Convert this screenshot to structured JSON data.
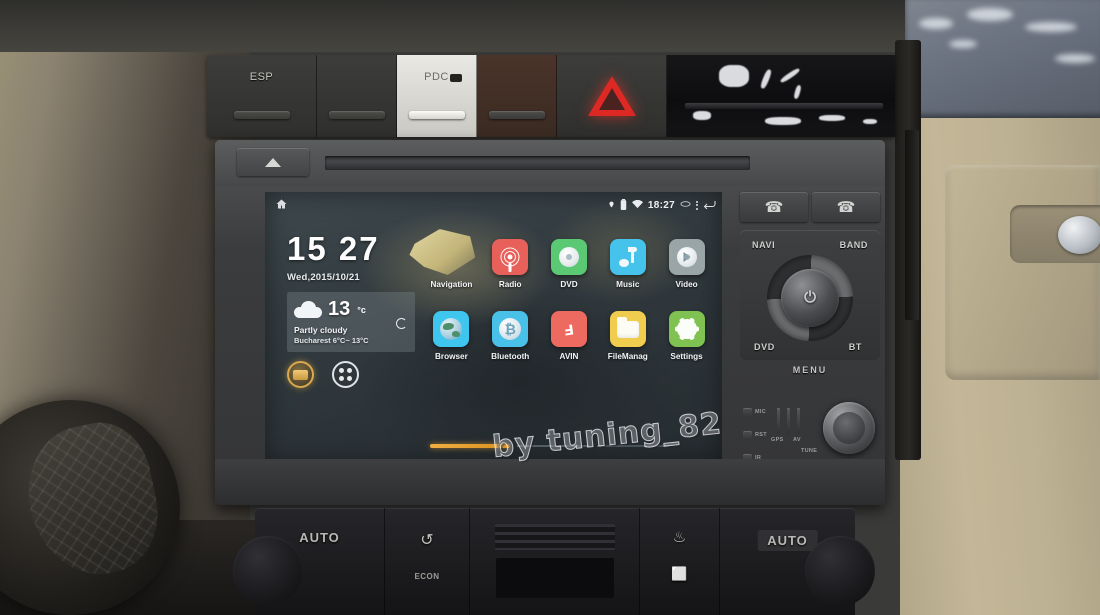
{
  "vehicle": {
    "switch_panel": {
      "esp_label": "ESP",
      "pdc_label": "PDC",
      "hazard_name": "hazard-warning"
    },
    "climate": {
      "auto_left": "AUTO",
      "auto_right": "AUTO",
      "recirc_glyph": "↺",
      "defrost_glyph": "♨",
      "rear_defrost_glyph": "⬜",
      "econ_label": "ECON"
    }
  },
  "head_unit": {
    "eject_label": "▲",
    "phone_answer_glyph": "✆",
    "phone_end_glyph": "✆",
    "knob_labels": {
      "navi": "NAVI",
      "band": "BAND",
      "dvd": "DVD",
      "bt": "BT",
      "power_glyph": "⏻"
    },
    "menu_label": "MENU",
    "mini_labels": {
      "mic": "MIC",
      "rst": "RST",
      "ir": "IR",
      "gps": "GPS",
      "av": "AV",
      "tune": "TUNE"
    }
  },
  "screen": {
    "status_bar": {
      "home_icon": "home-icon",
      "location_icon": "location-pin-icon",
      "battery_icon": "battery-icon",
      "wifi_icon": "wifi-icon",
      "clock": "18:27",
      "usb_icon": "usb-icon",
      "overflow_icon": "overflow-menu-icon",
      "back_icon": "back-arrow-icon"
    },
    "clock_widget": {
      "time": "15 27",
      "date": "Wed,2015/10/21"
    },
    "weather_widget": {
      "temperature": "13",
      "unit": "°c",
      "condition": "Partly cloudy",
      "location_range": "Bucharest 6°C~ 13°C",
      "icon": "cloud-icon",
      "refresh_icon": "refresh-icon"
    },
    "dock": [
      {
        "name": "car-info-shortcut",
        "icon": "car-icon"
      },
      {
        "name": "app-drawer",
        "icon": "app-drawer-icon"
      }
    ],
    "apps": [
      {
        "label": "Navigation",
        "icon": "map-icon",
        "color": "#d9c98a"
      },
      {
        "label": "Radio",
        "icon": "radio-icon",
        "color": "#e8605a"
      },
      {
        "label": "DVD",
        "icon": "disc-icon",
        "color": "#5bc874"
      },
      {
        "label": "Music",
        "icon": "music-note-icon",
        "color": "#46c3ea"
      },
      {
        "label": "Video",
        "icon": "video-icon",
        "color": "#9aa5a8"
      },
      {
        "label": "Browser",
        "icon": "globe-icon",
        "color": "#3fc6ee"
      },
      {
        "label": "Bluetooth",
        "icon": "bluetooth-icon",
        "color": "#49c0e8"
      },
      {
        "label": "AVIN",
        "icon": "avin-icon",
        "color": "#ed6a61"
      },
      {
        "label": "FileManag",
        "icon": "folder-icon",
        "color": "#f0cd4e"
      },
      {
        "label": "Settings",
        "icon": "gear-icon",
        "color": "#7fc252"
      }
    ],
    "page_indicator": {
      "current": 1,
      "total": 3
    }
  },
  "watermark": {
    "text": "by tuning_82"
  },
  "colors": {
    "accent_orange": "#f0b040",
    "dock_gold": "#d9a94b",
    "hazard_red": "#e62823"
  }
}
